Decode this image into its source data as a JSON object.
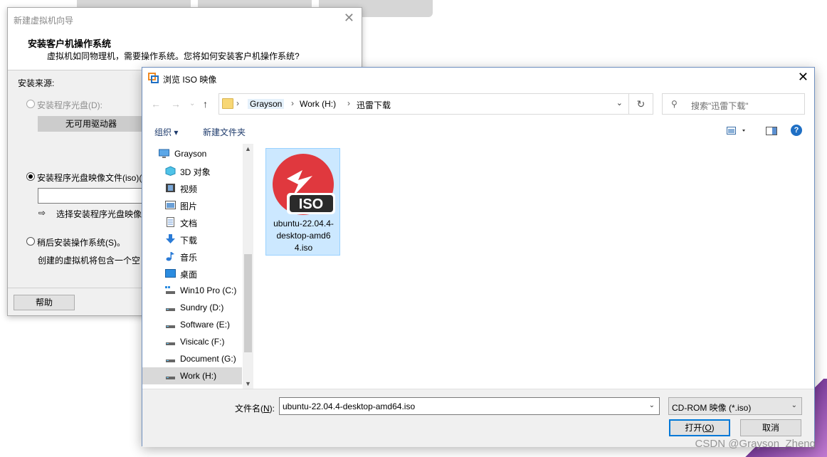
{
  "wizard": {
    "title": "新建虚拟机向导",
    "heading": "安装客户机操作系统",
    "subheading": "虚拟机如同物理机，需要操作系统。您将如何安装客户机操作系统?",
    "source_label": "安装来源:",
    "option_disc": "安装程序光盘(D):",
    "no_drive": "无可用驱动器",
    "option_iso": "安装程序光盘映像文件(iso)(",
    "iso_hint": "选择安装程序光盘映像",
    "option_later": "稍后安装操作系统(S)。",
    "later_desc": "创建的虚拟机将包含一个空",
    "help_btn": "帮助"
  },
  "browse": {
    "title": "浏览 ISO 映像",
    "breadcrumb": [
      "Grayson",
      "Work (H:)",
      "迅雷下载"
    ],
    "search_placeholder": "搜索\"迅雷下载\"",
    "toolbar": {
      "organize": "组织 ▾",
      "new_folder": "新建文件夹"
    },
    "nav_items": [
      {
        "label": "Grayson",
        "icon": "computer-icon"
      },
      {
        "label": "3D 对象",
        "icon": "cube-icon"
      },
      {
        "label": "视频",
        "icon": "video-icon"
      },
      {
        "label": "图片",
        "icon": "picture-icon"
      },
      {
        "label": "文档",
        "icon": "document-icon"
      },
      {
        "label": "下载",
        "icon": "download-icon"
      },
      {
        "label": "音乐",
        "icon": "music-icon"
      },
      {
        "label": "桌面",
        "icon": "desktop-icon"
      },
      {
        "label": "Win10 Pro (C:)",
        "icon": "drive-icon"
      },
      {
        "label": "Sundry (D:)",
        "icon": "drive-icon"
      },
      {
        "label": "Software (E:)",
        "icon": "drive-icon"
      },
      {
        "label": "Visicalc (F:)",
        "icon": "drive-icon"
      },
      {
        "label": "Document (G:)",
        "icon": "drive-icon"
      },
      {
        "label": "Work (H:)",
        "icon": "drive-icon"
      }
    ],
    "file": {
      "name": "ubuntu-22.04.4-desktop-amd64.iso",
      "display": "ubuntu-22.04.4-desktop-amd64.iso",
      "badge": "ISO"
    },
    "filename_label": "文件名(N):",
    "filename_value": "ubuntu-22.04.4-desktop-amd64.iso",
    "filetype_value": "CD-ROM 映像 (*.iso)",
    "open_btn": "打开(O)",
    "cancel_btn": "取消"
  },
  "watermark": "CSDN @Grayson_Zheng",
  "colors": {
    "accent": "#0078d7",
    "selection": "#cce8ff",
    "iso_red": "#e0383e"
  }
}
